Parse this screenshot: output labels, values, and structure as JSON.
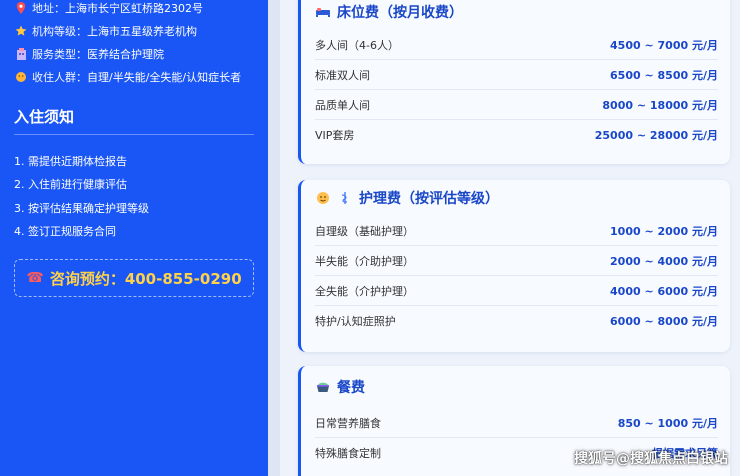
{
  "sidebar": {
    "info": [
      {
        "icon": "pin-icon",
        "label": "地址：",
        "value": "上海市长宁区虹桥路2302号"
      },
      {
        "icon": "star-icon",
        "label": "机构等级：",
        "value": "上海市五星级养老机构"
      },
      {
        "icon": "building-icon",
        "label": "服务类型：",
        "value": "医养结合护理院"
      },
      {
        "icon": "people-icon",
        "label": "收住人群：",
        "value": "自理/半失能/全失能/认知症长者"
      }
    ],
    "notes_title": "入住须知",
    "notes": [
      "1. 需提供近期体检报告",
      "2. 入住前进行健康评估",
      "3. 按评估结果确定护理等级",
      "4. 签订正规服务合同"
    ],
    "contact": "咨询预约：400-855-0290"
  },
  "cards": [
    {
      "title": "床位费（按月收费）",
      "rows": [
        {
          "name": "多人间（4-6人）",
          "price": "4500 ~ 7000 元/月"
        },
        {
          "name": "标准双人间",
          "price": "6500 ~ 8500 元/月"
        },
        {
          "name": "品质单人间",
          "price": "8000 ~ 18000 元/月"
        },
        {
          "name": "VIP套房",
          "price": "25000 ~ 28000 元/月"
        }
      ]
    },
    {
      "title": "护理费（按评估等级）",
      "rows": [
        {
          "name": "自理级（基础护理）",
          "price": "1000 ~ 2000 元/月"
        },
        {
          "name": "半失能（介助护理）",
          "price": "2000 ~ 4000 元/月"
        },
        {
          "name": "全失能（介护护理）",
          "price": "4000 ~ 6000 元/月"
        },
        {
          "name": "特护/认知症照护",
          "price": "6000 ~ 8000 元/月"
        }
      ]
    },
    {
      "title": "餐费",
      "rows": [
        {
          "name": "日常营养膳食",
          "price": "850 ~ 1000 元/月"
        },
        {
          "name": "特殊膳食定制",
          "price": "根据需求另算"
        }
      ]
    }
  ],
  "watermark": "搜狐号@搜狐焦点白银站",
  "colors": {
    "sidebar": "#1a56f5",
    "accent": "#1a47c8",
    "contact": "#ffd24a"
  }
}
